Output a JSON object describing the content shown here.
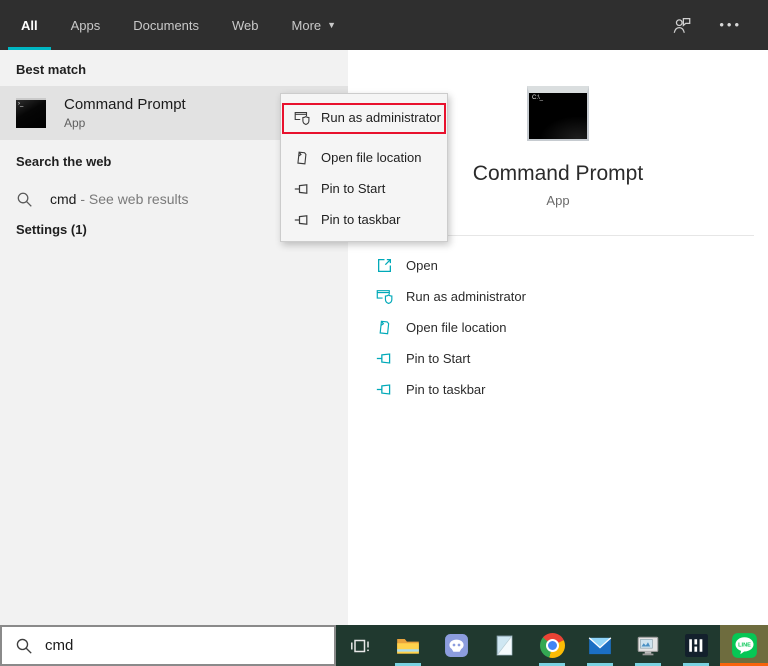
{
  "header": {
    "tabs": [
      {
        "label": "All",
        "active": true
      },
      {
        "label": "Apps",
        "active": false
      },
      {
        "label": "Documents",
        "active": false
      },
      {
        "label": "Web",
        "active": false
      },
      {
        "label": "More",
        "active": false,
        "dropdown": true
      }
    ],
    "icons": [
      {
        "name": "feedback-user-icon"
      },
      {
        "name": "more-options-icon"
      }
    ]
  },
  "left_panel": {
    "sections": {
      "best_match": "Best match",
      "search_web": "Search the web",
      "settings": "Settings (1)"
    },
    "best_match_item": {
      "title": "Command Prompt",
      "subtitle": "App",
      "icon": "command-prompt-icon"
    },
    "web_item": {
      "query": "cmd",
      "suffix": "- See web results",
      "icon": "search-icon"
    }
  },
  "context_menu": {
    "items": [
      {
        "label": "Run as administrator",
        "icon": "run-as-admin-icon",
        "annotated": true
      },
      {
        "label": "Open file location",
        "icon": "open-file-location-icon",
        "annotated": false
      },
      {
        "label": "Pin to Start",
        "icon": "pin-icon",
        "annotated": false
      },
      {
        "label": "Pin to taskbar",
        "icon": "pin-icon",
        "annotated": false
      }
    ],
    "annotation_color": "#e8112d"
  },
  "right_panel": {
    "app": {
      "title": "Command Prompt",
      "subtitle": "App",
      "icon": "command-prompt-icon"
    },
    "actions": [
      {
        "label": "Open",
        "icon": "open-icon"
      },
      {
        "label": "Run as administrator",
        "icon": "run-as-admin-icon"
      },
      {
        "label": "Open file location",
        "icon": "open-file-location-icon"
      },
      {
        "label": "Pin to Start",
        "icon": "pin-icon"
      },
      {
        "label": "Pin to taskbar",
        "icon": "pin-icon"
      }
    ],
    "accent_color": "#00a9b8"
  },
  "search_bar": {
    "value": "cmd",
    "icon": "search-icon"
  },
  "taskbar": {
    "items": [
      {
        "name": "task-view",
        "running": false,
        "active": false
      },
      {
        "name": "file-explorer",
        "running": true,
        "active": false
      },
      {
        "name": "discord",
        "running": false,
        "active": false
      },
      {
        "name": "notepad",
        "running": false,
        "active": false
      },
      {
        "name": "chrome",
        "running": true,
        "active": false
      },
      {
        "name": "mail",
        "running": true,
        "active": false
      },
      {
        "name": "photos",
        "running": true,
        "active": false
      },
      {
        "name": "audio-bars-app",
        "running": true,
        "active": false
      },
      {
        "name": "line",
        "running": true,
        "active": true
      }
    ],
    "colors": {
      "background": "#20392f",
      "active_background": "#6e6c3e",
      "running_indicator": "#7ad1e0",
      "active_indicator": "#f7630c"
    }
  },
  "colors": {
    "topbar_bg": "#2f2f2f",
    "accent_teal": "#00b7c3",
    "panel_bg": "#f2f2f2",
    "highlight_row": "#e2e2e2",
    "annotation_red": "#e8112d"
  }
}
